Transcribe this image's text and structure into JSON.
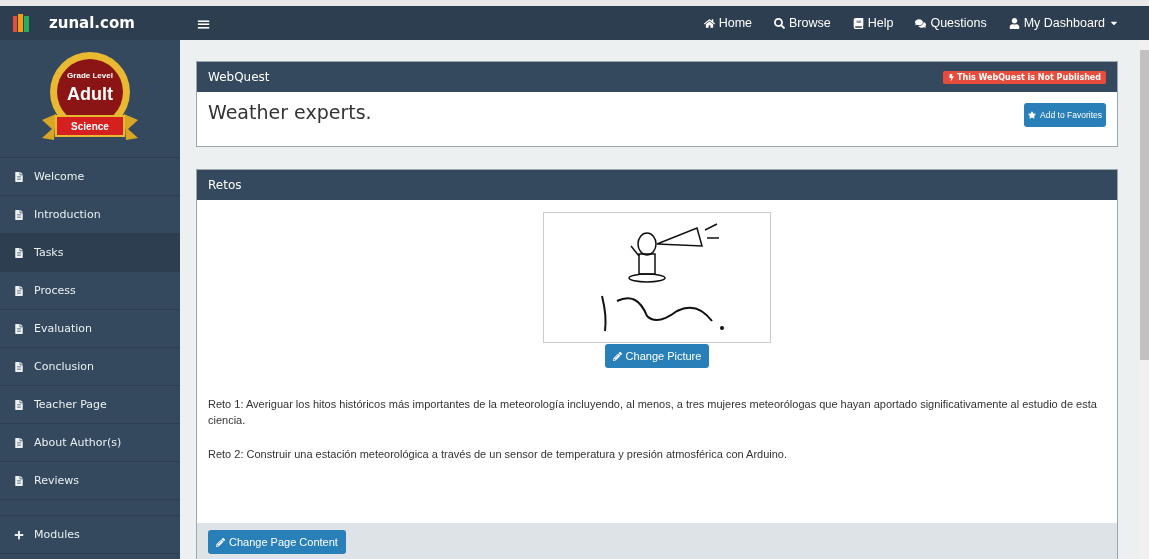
{
  "navbar": {
    "brand": "zunal.com",
    "menu_icon": "≡",
    "links": [
      {
        "kind": "home",
        "label": "Home"
      },
      {
        "kind": "search",
        "label": "Browse"
      },
      {
        "kind": "book",
        "label": "Help"
      },
      {
        "kind": "comments",
        "label": "Questions"
      },
      {
        "kind": "user",
        "label": "My Dashboard",
        "dropdown": true
      }
    ]
  },
  "sidebar": {
    "badge": {
      "top": "Grade Level",
      "middle": "Adult",
      "ribbon": "Science"
    },
    "items": [
      {
        "label": "Welcome",
        "selected": false
      },
      {
        "label": "Introduction",
        "selected": false
      },
      {
        "label": "Tasks",
        "selected": true
      },
      {
        "label": "Process",
        "selected": false
      },
      {
        "label": "Evaluation",
        "selected": false
      },
      {
        "label": "Conclusion",
        "selected": false
      },
      {
        "label": "Teacher Page",
        "selected": false
      },
      {
        "label": "About Author(s)",
        "selected": false
      },
      {
        "label": "Reviews",
        "selected": false
      }
    ],
    "modules": "Modules"
  },
  "webquest_panel": {
    "heading": "WebQuest",
    "status_badge": "This WebQuest is Not Published",
    "title": "Weather experts.",
    "favorite_button": "Add to Favorites"
  },
  "content_panel": {
    "heading": "Retos",
    "change_picture_button": "Change Picture",
    "paragraphs": [
      "Reto 1:  Averiguar los hitos históricos más importantes de la meteorología incluyendo, al menos, a tres mujeres meteorólogas que hayan aportado significativamente al estudio de esta ciencia.",
      "Reto 2: Construir una estación meteorológica a través de un sensor de temperatura y presión atmosférica con Arduino."
    ],
    "change_content_button": "Change Page Content"
  }
}
